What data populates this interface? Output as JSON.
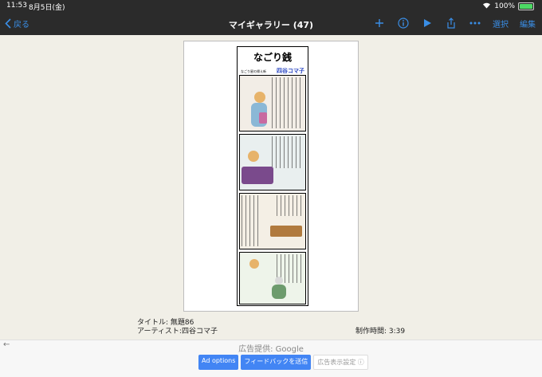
{
  "status": {
    "time": "11:53",
    "date": "8月5日(金)",
    "battery": "100%"
  },
  "nav": {
    "back": "戻る",
    "title": "マイギャラリー (47)",
    "select": "選択",
    "edit": "編集"
  },
  "comic": {
    "title": "なごり銭",
    "subtitle": "なごり星の帰え新",
    "author": "四谷コマ子"
  },
  "meta": {
    "title_line": "タイトル: 無題86",
    "artist_line": "アーティスト:四谷コマ子",
    "time_line": "制作時間:  3:39"
  },
  "ad": {
    "provider": "広告提供: Google",
    "buttons": [
      "Ad options",
      "フィードバックを送信",
      "広告表示設定 ⓘ"
    ]
  },
  "colors": {
    "accent": "#3a8ee6",
    "bar": "#2b2b2b",
    "adblue": "#4285f4"
  }
}
